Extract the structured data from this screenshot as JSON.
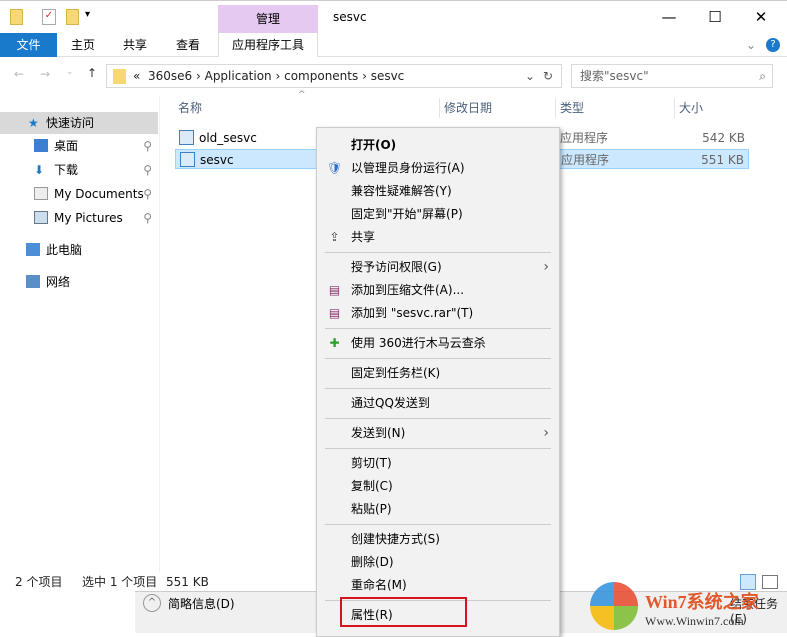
{
  "window": {
    "title": "sesvc",
    "context_tab": "管理",
    "minimize": "—",
    "maximize": "☐",
    "close": "✕"
  },
  "ribbon": {
    "tabs": [
      "文件",
      "主页",
      "共享",
      "查看"
    ],
    "context_tab": "应用程序工具"
  },
  "address": {
    "overflow": "«",
    "path": [
      "360se6",
      "Application",
      "components",
      "sesvc"
    ],
    "search_placeholder": "搜索\"sesvc\""
  },
  "nav": {
    "items": [
      "快速访问",
      "桌面",
      "下载",
      "My Documents",
      "My Pictures",
      "此电脑",
      "网络"
    ]
  },
  "columns": [
    "名称",
    "修改日期",
    "类型",
    "大小"
  ],
  "files": [
    {
      "name": "old_sesvc",
      "type": "应用程序",
      "size": "542 KB"
    },
    {
      "name": "sesvc",
      "type": "应用程序",
      "size": "551 KB"
    }
  ],
  "status": {
    "count": "2 个项目",
    "selected": "选中 1 个项目",
    "size": "551 KB"
  },
  "background_window": {
    "details": "简略信息(D)",
    "end_task": "结束任务(E)"
  },
  "context_menu": [
    {
      "label": "打开(O)",
      "bold": true
    },
    {
      "label": "以管理员身份运行(A)",
      "icon": "shield"
    },
    {
      "label": "兼容性疑难解答(Y)"
    },
    {
      "label": "固定到\"开始\"屏幕(P)"
    },
    {
      "label": "共享",
      "icon": "share"
    },
    {
      "sep": true
    },
    {
      "label": "授予访问权限(G)",
      "submenu": true
    },
    {
      "label": "添加到压缩文件(A)...",
      "icon": "rar"
    },
    {
      "label": "添加到 \"sesvc.rar\"(T)",
      "icon": "rar"
    },
    {
      "sep": true
    },
    {
      "label": "使用 360进行木马云查杀",
      "icon": "360"
    },
    {
      "sep": true
    },
    {
      "label": "固定到任务栏(K)"
    },
    {
      "sep": true
    },
    {
      "label": "通过QQ发送到"
    },
    {
      "sep": true
    },
    {
      "label": "发送到(N)",
      "submenu": true
    },
    {
      "sep": true
    },
    {
      "label": "剪切(T)"
    },
    {
      "label": "复制(C)"
    },
    {
      "label": "粘贴(P)"
    },
    {
      "sep": true
    },
    {
      "label": "创建快捷方式(S)"
    },
    {
      "label": "删除(D)"
    },
    {
      "label": "重命名(M)"
    },
    {
      "sep": true
    },
    {
      "label": "属性(R)"
    }
  ],
  "watermark": {
    "brand": "Win7系统之家",
    "url": "Www.Winwin7.com"
  }
}
